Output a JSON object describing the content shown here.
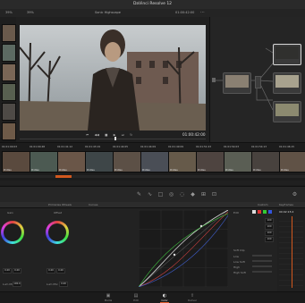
{
  "window": {
    "title": "DaVinci Resolve 12"
  },
  "viewer_bar": {
    "zoom": "39%",
    "zoom_right": "39%",
    "clip_name": "Sonic Highscape",
    "timecode": "01:00:42:00"
  },
  "viewer": {
    "timecode": "01:00:42:00"
  },
  "timeline": {
    "clips": [
      {
        "tc": "01:01:00:03",
        "codec": "ProRes"
      },
      {
        "tc": "01:01:00:48",
        "codec": "ProRes"
      },
      {
        "tc": "01:01:41:12",
        "codec": "ProRes"
      },
      {
        "tc": "01:01:43:19",
        "codec": "ProRes"
      },
      {
        "tc": "01:01:44:05",
        "codec": "ProRes"
      },
      {
        "tc": "01:01:44:09",
        "codec": "ProRes"
      },
      {
        "tc": "01:01:49:09",
        "codec": "ProRes"
      },
      {
        "tc": "01:01:51:23",
        "codec": "ProRes"
      },
      {
        "tc": "01:01:54:03",
        "codec": "ProRes"
      },
      {
        "tc": "01:01:54:13",
        "codec": "ProRes"
      },
      {
        "tc": "01:01:46:15",
        "codec": "ProRes"
      }
    ]
  },
  "panels": {
    "wheels_title": "Primaries Wheels",
    "gain_label": "Gain",
    "offset_label": "Offset",
    "wheel_values": [
      "0.00",
      "0.00",
      "0.00",
      "0.00"
    ],
    "curves_title": "Curves",
    "rgb_title": "Custom",
    "edit_label": "Edit",
    "rgb_values": [
      "100",
      "100",
      "100",
      "100"
    ],
    "soft_clip_label": "Soft Clip",
    "soft_clip_rows": [
      "Low",
      "Low Soft",
      "High",
      "High Soft"
    ],
    "keyframes_title": "Keyframes",
    "keyframes_tc": "00:02:15:2",
    "bottom_left_value": "100.0",
    "bottom_left_value2": "0.00",
    "bottom_left_label": "Lum Mix",
    "bottom_left_label2": "Lum Mix"
  },
  "page_tabs": [
    {
      "label": "Media",
      "icon": "media-icon"
    },
    {
      "label": "Edit",
      "icon": "edit-icon"
    },
    {
      "label": "Color",
      "icon": "color-icon",
      "active": true
    },
    {
      "label": "Deliver",
      "icon": "deliver-icon"
    }
  ]
}
